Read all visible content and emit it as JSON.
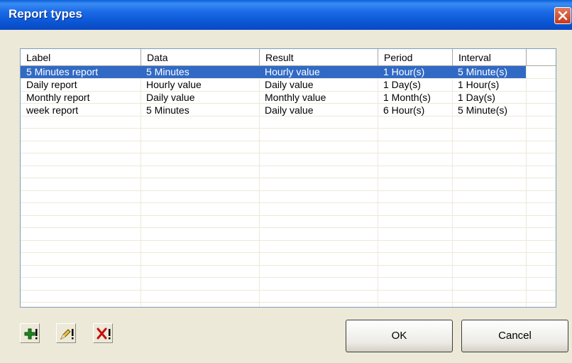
{
  "window": {
    "title": "Report types"
  },
  "table": {
    "columns": [
      "Label",
      "Data",
      "Result",
      "Period",
      "Interval"
    ],
    "rows": [
      [
        "5 Minutes report",
        "5 Minutes",
        "Hourly value",
        "1 Hour(s)",
        "5 Minute(s)"
      ],
      [
        "Daily report",
        "Hourly value",
        "Daily value",
        "1 Day(s)",
        "1 Hour(s)"
      ],
      [
        "Monthly report",
        "Daily value",
        "Monthly value",
        "1 Month(s)",
        "1 Day(s)"
      ],
      [
        "week report",
        "5 Minutes",
        "Daily value",
        "6 Hour(s)",
        "5 Minute(s)"
      ]
    ],
    "selected_row": 0
  },
  "toolbar": {
    "add_icon": "add-icon",
    "edit_icon": "edit-icon",
    "delete_icon": "delete-icon"
  },
  "buttons": {
    "ok_label": "OK",
    "cancel_label": "Cancel"
  },
  "colors": {
    "titlebar": "#0a55d3",
    "selection": "#316ac5",
    "dialog_bg": "#ece9d8"
  }
}
